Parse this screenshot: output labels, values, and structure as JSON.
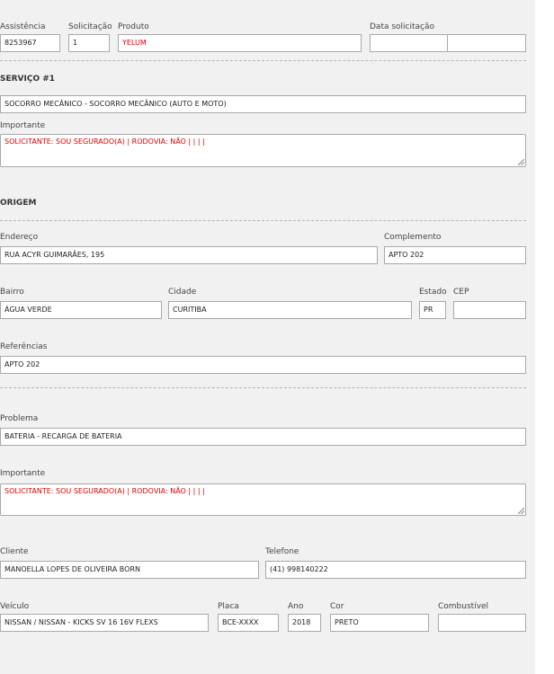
{
  "header": {
    "assistencia_label": "Assistência",
    "assistencia_value": "8253967",
    "solicitacao_label": "Solicitação",
    "solicitacao_value": "1",
    "produto_label": "Produto",
    "produto_value": "YELUM",
    "data_solicitacao_label": "Data solicitação",
    "data_value_1": "",
    "data_value_2": ""
  },
  "servico": {
    "title": "SERVIÇO #1",
    "service_value": "SOCORRO MECÂNICO - SOCORRO MECÂNICO (AUTO E MOTO)",
    "importante_label": "Importante",
    "importante_value": "SOLICITANTE: SOU SEGURADO(A) | RODOVIA: NÃO |  |  |  |"
  },
  "origem": {
    "title": "ORIGEM",
    "endereco_label": "Endereço",
    "endereco_value": "RUA ACYR GUIMARÃES, 195",
    "complemento_label": "Complemento",
    "complemento_value": "APTO 202",
    "bairro_label": "Bairro",
    "bairro_value": "ÁGUA VERDE",
    "cidade_label": "Cidade",
    "cidade_value": "CURITIBA",
    "estado_label": "Estado",
    "estado_value": "PR",
    "cep_label": "CEP",
    "cep_value": "",
    "referencias_label": "Referências",
    "referencias_value": "APTO 202"
  },
  "problema": {
    "problema_label": "Problema",
    "problema_value": "BATERIA - RECARGA DE BATERIA",
    "importante_label": "Importante",
    "importante_value": "SOLICITANTE: SOU SEGURADO(A) | RODOVIA: NÃO |  |  |  |"
  },
  "cliente": {
    "cliente_label": "Cliente",
    "cliente_value": "MANOELLA LOPES DE OLIVEIRA BORN",
    "telefone_label": "Telefone",
    "telefone_value": "(41) 998140222"
  },
  "veiculo": {
    "veiculo_label": "Veículo",
    "veiculo_value": "NISSAN / NISSAN - KICKS SV 16 16V FLEXS",
    "placa_label": "Placa",
    "placa_value": "BCE-XXXX",
    "ano_label": "Ano",
    "ano_value": "2018",
    "cor_label": "Cor",
    "cor_value": "PRETO",
    "combustivel_label": "Combustível",
    "combustivel_value": ""
  },
  "colors": {
    "panel_bg": "#f1f1f1",
    "highlight_text": "#e00000",
    "input_border": "#a9a9a9"
  }
}
